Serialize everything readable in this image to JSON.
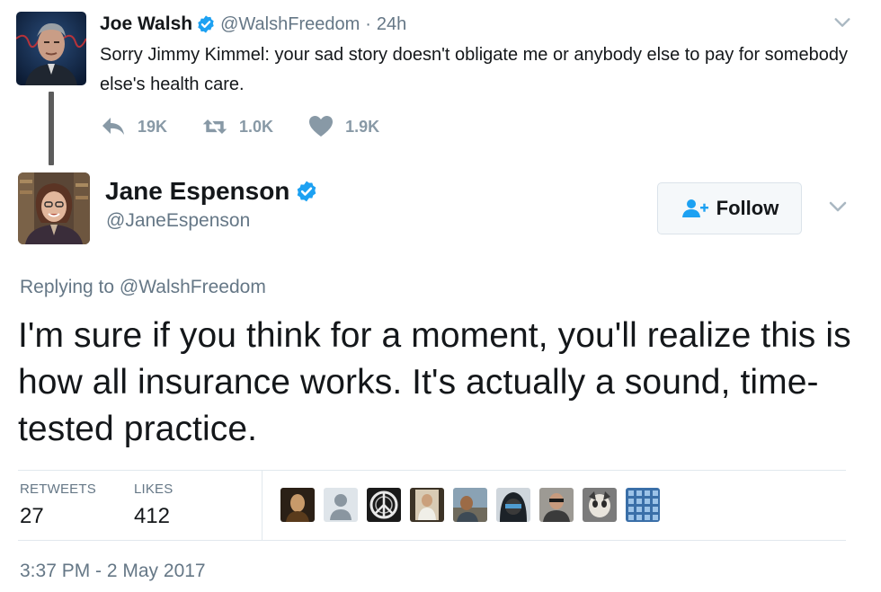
{
  "parent_tweet": {
    "name": "Joe Walsh",
    "handle": "@WalshFreedom",
    "separator": "·",
    "time": "24h",
    "text": "Sorry Jimmy Kimmel: your sad story doesn't obligate me or anybody else to pay for somebody else's health care.",
    "reply_count": "19K",
    "retweet_count": "1.0K",
    "like_count": "1.9K"
  },
  "main_tweet": {
    "name": "Jane Espenson",
    "handle": "@JaneEspenson",
    "follow_label": "Follow",
    "replying_prefix": "Replying to",
    "replying_to": "@WalshFreedom",
    "text": "I'm sure if you think for a moment, you'll realize this is how all insurance works. It's actually a sound, time-tested practice.",
    "retweets_label": "RETWEETS",
    "retweets": "27",
    "likes_label": "LIKES",
    "likes": "412",
    "timestamp": "3:37 PM - 2 May 2017"
  },
  "colors": {
    "verified": "#1da1f2",
    "action_gray": "#8899a6",
    "secondary_text": "#657786"
  },
  "icons": {
    "verified": "verified-badge-icon",
    "reply": "reply-icon",
    "retweet": "retweet-icon",
    "like": "heart-icon",
    "caret": "chevron-down-icon",
    "follow": "add-user-icon"
  }
}
